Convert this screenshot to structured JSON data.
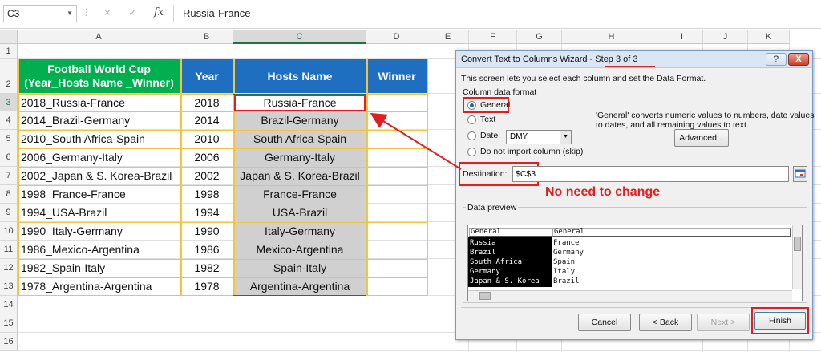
{
  "formula_bar": {
    "name_box": "C3",
    "cancel_icon": "×",
    "enter_icon": "✓",
    "fx_label": "fx",
    "formula": "Russia-France"
  },
  "sheet": {
    "columns": [
      "A",
      "B",
      "C",
      "D",
      "E",
      "F",
      "G",
      "H",
      "I",
      "J",
      "K"
    ],
    "rows": [
      "1",
      "2",
      "3",
      "4",
      "5",
      "6",
      "7",
      "8",
      "9",
      "10",
      "11",
      "12",
      "13",
      "14",
      "15",
      "16"
    ],
    "header": {
      "a_line1": "Football World Cup",
      "a_line2": "(Year_Hosts Name _Winner)",
      "b": "Year",
      "c": "Hosts Name",
      "d": "Winner"
    },
    "data": [
      {
        "a": "2018_Russia-France",
        "b": "2018",
        "c": "Russia-France"
      },
      {
        "a": "2014_Brazil-Germany",
        "b": "2014",
        "c": "Brazil-Germany"
      },
      {
        "a": "2010_South Africa-Spain",
        "b": "2010",
        "c": "South Africa-Spain"
      },
      {
        "a": "2006_Germany-Italy",
        "b": "2006",
        "c": "Germany-Italy"
      },
      {
        "a": "2002_Japan & S. Korea-Brazil",
        "b": "2002",
        "c": "Japan & S. Korea-Brazil"
      },
      {
        "a": "1998_France-France",
        "b": "1998",
        "c": "France-France"
      },
      {
        "a": "1994_USA-Brazil",
        "b": "1994",
        "c": "USA-Brazil"
      },
      {
        "a": "1990_Italy-Germany",
        "b": "1990",
        "c": "Italy-Germany"
      },
      {
        "a": "1986_Mexico-Argentina",
        "b": "1986",
        "c": "Mexico-Argentina"
      },
      {
        "a": "1982_Spain-Italy",
        "b": "1982",
        "c": "Spain-Italy"
      },
      {
        "a": "1978_Argentina-Argentina",
        "b": "1978",
        "c": "Argentina-Argentina"
      }
    ]
  },
  "dialog": {
    "title_prefix": "Convert Text to Columns Wizard - ",
    "title_step": "Step 3 of 3",
    "help_btn": "?",
    "close_btn": "X",
    "intro": "This screen lets you select each column and set the Data Format.",
    "column_format_label": "Column data format",
    "opt_general": "General",
    "opt_text": "Text",
    "opt_date": "Date:",
    "date_value": "DMY",
    "opt_skip": "Do not import column (skip)",
    "desc_line1": "'General' converts numeric values to numbers, date values",
    "desc_line2": "to dates, and all remaining values to text.",
    "advanced_btn": "Advanced...",
    "destination_label": "Destination:",
    "destination_value": "$C$3",
    "preview_label": "Data preview",
    "preview_headers": [
      "General",
      "General"
    ],
    "preview_col1": [
      "Russia",
      "Brazil",
      "South Africa",
      "Germany",
      "Japan & S. Korea"
    ],
    "preview_col2": [
      "France",
      "Germany",
      "Spain",
      "Italy",
      "Brazil"
    ],
    "cancel_btn": "Cancel",
    "back_btn": "< Back",
    "next_btn": "Next >",
    "finish_btn": "Finish"
  },
  "annotation": {
    "text": "No need to change"
  },
  "colors": {
    "green_header": "#00b050",
    "blue_header": "#1f6fc0",
    "red_annotation": "#e02020",
    "yellow_border": "#f5c242"
  }
}
